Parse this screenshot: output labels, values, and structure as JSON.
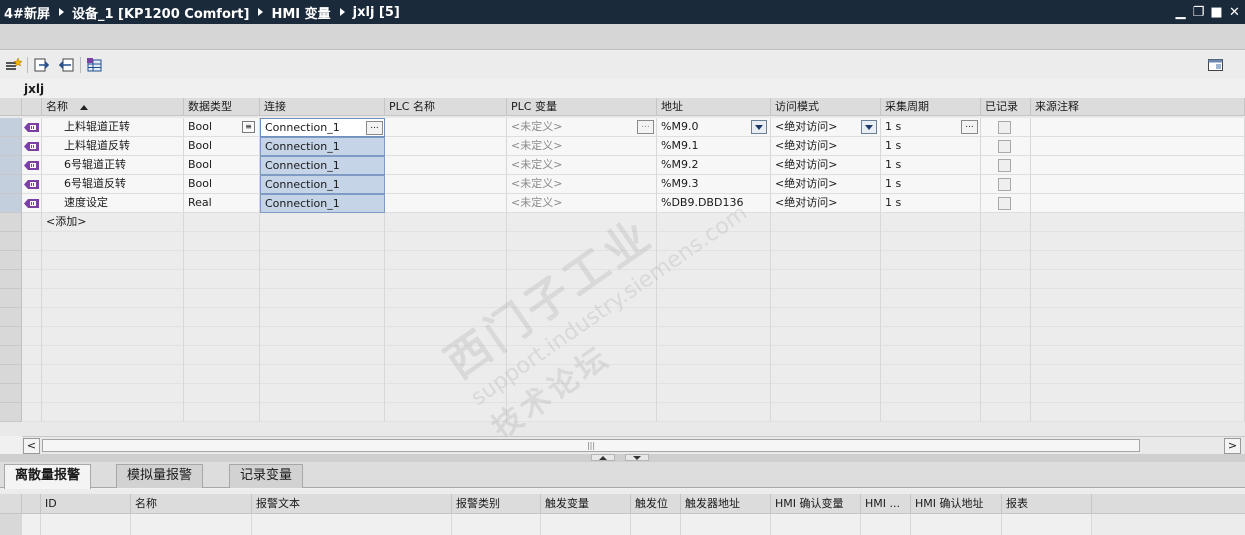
{
  "title": {
    "crumbs": [
      "4#新屏",
      "设备_1 [KP1200 Comfort]",
      "HMI 变量",
      "jxlj [5]"
    ],
    "controls": [
      "▁",
      "❐",
      "■",
      "✕"
    ]
  },
  "table_name": "jxlj",
  "columns": [
    {
      "key": "name",
      "label": "名称"
    },
    {
      "key": "dtype",
      "label": "数据类型"
    },
    {
      "key": "conn",
      "label": "连接"
    },
    {
      "key": "plcname",
      "label": "PLC 名称"
    },
    {
      "key": "plcvar",
      "label": "PLC 变量"
    },
    {
      "key": "addr",
      "label": "地址"
    },
    {
      "key": "access",
      "label": "访问模式"
    },
    {
      "key": "cycle",
      "label": "采集周期"
    },
    {
      "key": "logged",
      "label": "已记录"
    },
    {
      "key": "comment",
      "label": "来源注释"
    }
  ],
  "rows": [
    {
      "name": "上料辊道正转",
      "dtype": "Bool",
      "conn": "Connection_1",
      "plcvar": "<未定义>",
      "addr": "%M9.0",
      "access": "<绝对访问>",
      "cycle": "1 s"
    },
    {
      "name": "上料辊道反转",
      "dtype": "Bool",
      "conn": "Connection_1",
      "plcvar": "<未定义>",
      "addr": "%M9.1",
      "access": "<绝对访问>",
      "cycle": "1 s"
    },
    {
      "name": "6号辊道正转",
      "dtype": "Bool",
      "conn": "Connection_1",
      "plcvar": "<未定义>",
      "addr": "%M9.2",
      "access": "<绝对访问>",
      "cycle": "1 s"
    },
    {
      "name": "6号辊道反转",
      "dtype": "Bool",
      "conn": "Connection_1",
      "plcvar": "<未定义>",
      "addr": "%M9.3",
      "access": "<绝对访问>",
      "cycle": "1 s"
    },
    {
      "name": "速度设定",
      "dtype": "Real",
      "conn": "Connection_1",
      "plcvar": "<未定义>",
      "addr": "%DB9.DBD136",
      "access": "<绝对访问>",
      "cycle": "1 s"
    }
  ],
  "add_row": "<添加>",
  "ellipsis": "...",
  "scroll_grip": "|||",
  "scroll_left": "<",
  "scroll_right": ">",
  "tabs": [
    "离散量报警",
    "模拟量报警",
    "记录变量"
  ],
  "alarm_columns": [
    "ID",
    "名称",
    "报警文本",
    "报警类别",
    "触发变量",
    "触发位",
    "触发器地址",
    "HMI 确认变量",
    "HMI ...",
    "HMI 确认地址",
    "报表"
  ],
  "watermark": {
    "line1": "西门子工业",
    "line2": "support.industry.siemens.com",
    "line3": "技术论坛"
  },
  "icons": {
    "tag": "hmi-tag-icon",
    "sort": "sort-ascending-icon",
    "toolbar": [
      "add-tag-icon",
      "export-icon",
      "import-icon",
      "tag-table-icon",
      "panel-layout-icon"
    ]
  },
  "colors": {
    "titlebar": "#1b2a3a",
    "selection": "#c6d4e8",
    "tag_icon": "#7b3fa6"
  }
}
